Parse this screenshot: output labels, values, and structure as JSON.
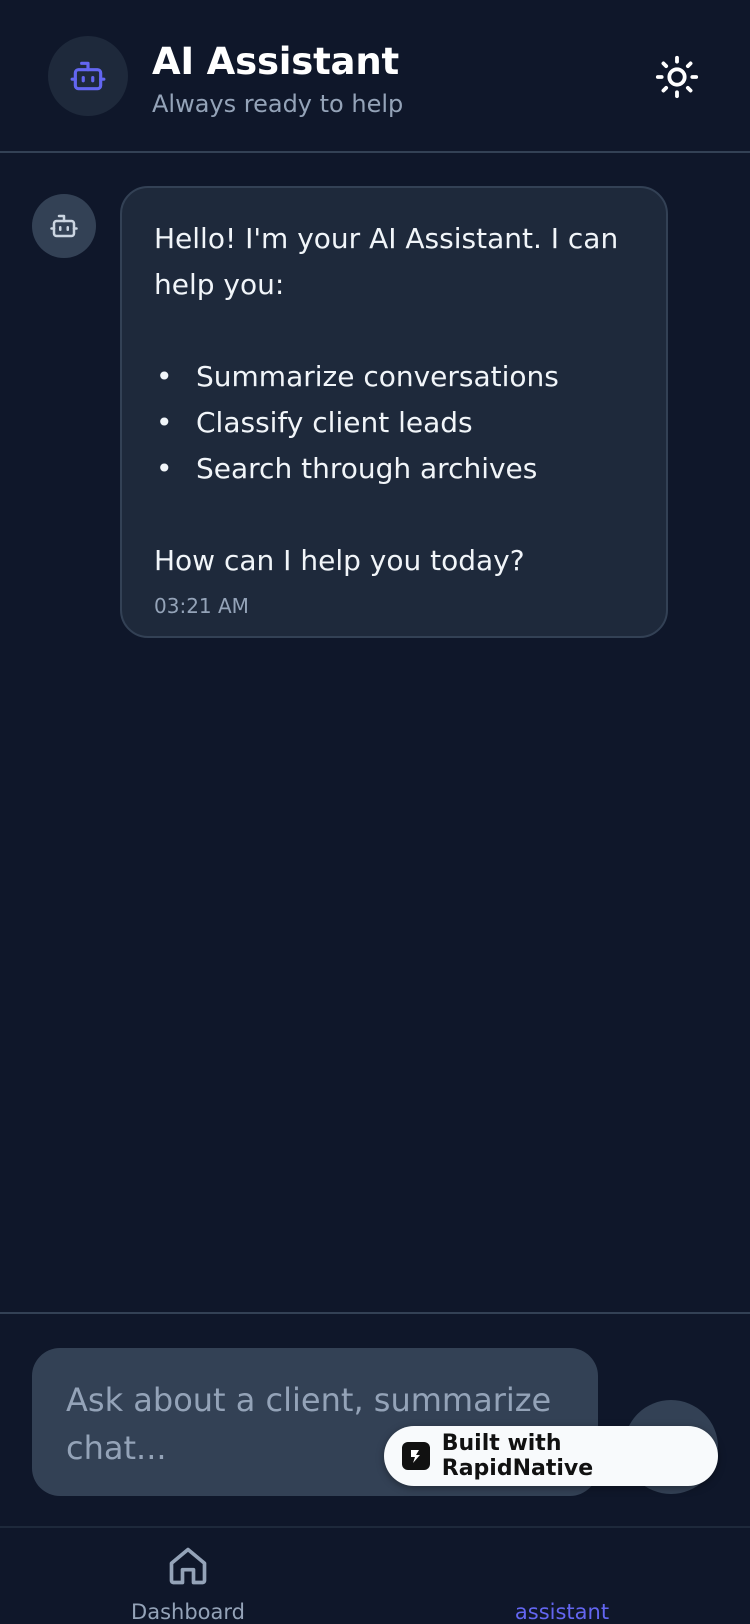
{
  "header": {
    "avatar_icon": "robot-icon",
    "title": "AI Assistant",
    "subtitle": "Always ready to help",
    "theme_icon": "sun-icon"
  },
  "message": {
    "avatar_icon": "robot-icon",
    "intro": "Hello! I'm your AI Assistant. I can help you:",
    "bullets": [
      "Summarize conversations",
      "Classify client leads",
      "Search through archives"
    ],
    "closing": "How can I help you today?",
    "time": "03:21 AM"
  },
  "composer": {
    "placeholder": "Ask about a client, summarize chat...",
    "send_icon": "send-icon"
  },
  "badge": {
    "text": "Built with RapidNative",
    "logo_icon": "rapidnative-logo-icon"
  },
  "nav": {
    "items": [
      {
        "label": "Dashboard",
        "icon": "home-icon",
        "active": false
      },
      {
        "label": "assistant",
        "icon": "robot-icon",
        "active": true
      }
    ]
  },
  "colors": {
    "background": "#0f172a",
    "surface": "#1e293b",
    "input": "#334155",
    "accent": "#6366f1",
    "muted": "#94a3b8"
  }
}
